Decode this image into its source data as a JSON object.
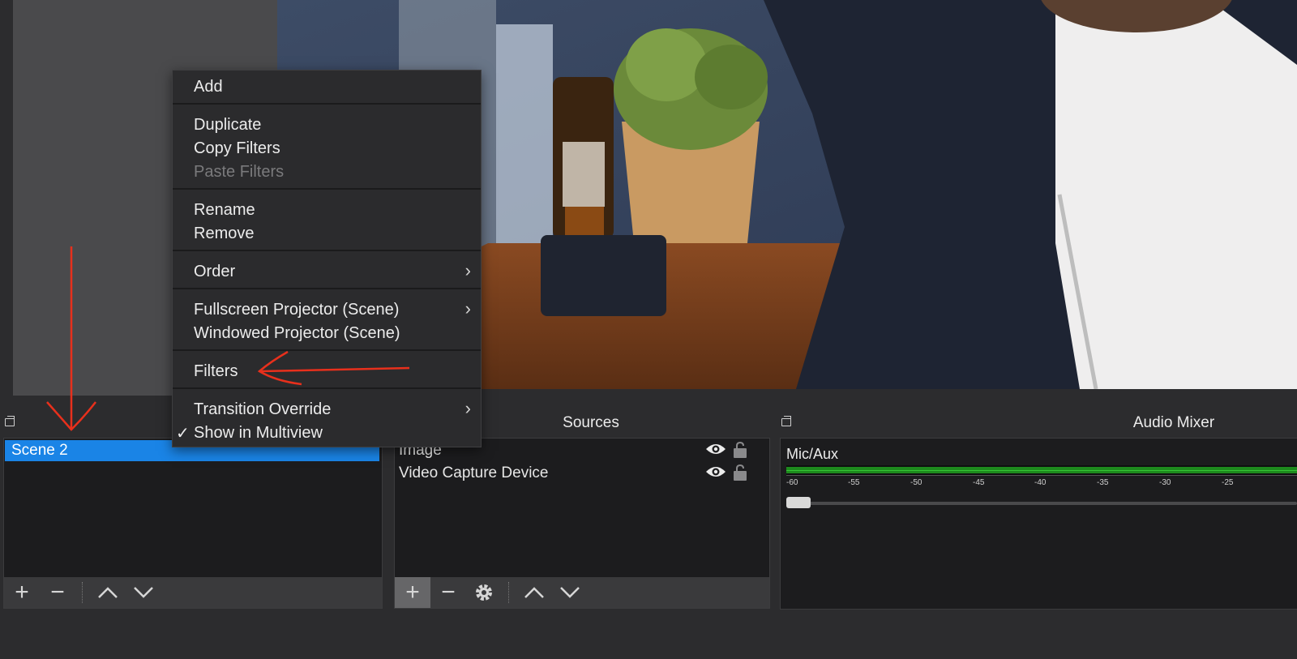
{
  "menu": {
    "items": {
      "add": "Add",
      "duplicate": "Duplicate",
      "copy_filters": "Copy Filters",
      "paste_filters": "Paste Filters",
      "rename": "Rename",
      "remove": "Remove",
      "order": "Order",
      "fullscreen_projector": "Fullscreen Projector (Scene)",
      "windowed_projector": "Windowed Projector (Scene)",
      "filters": "Filters",
      "transition_override": "Transition Override",
      "show_in_multiview": "Show in Multiview"
    },
    "submenu_glyph": "›",
    "check_glyph": "✓"
  },
  "scenes": {
    "items": [
      "Scene 2"
    ]
  },
  "sources": {
    "title": "Sources",
    "items": [
      "Image",
      "Video Capture Device"
    ]
  },
  "mixer": {
    "title": "Audio Mixer",
    "channel": "Mic/Aux",
    "ticks": [
      "-60",
      "-55",
      "-50",
      "-45",
      "-40",
      "-35",
      "-30",
      "-25"
    ]
  },
  "toolbar": {
    "add_glyph": "+",
    "remove_glyph": "−"
  },
  "colors": {
    "accent": "#1a84e6",
    "meter": "#1d8a1d",
    "annotation": "#e8301c"
  }
}
